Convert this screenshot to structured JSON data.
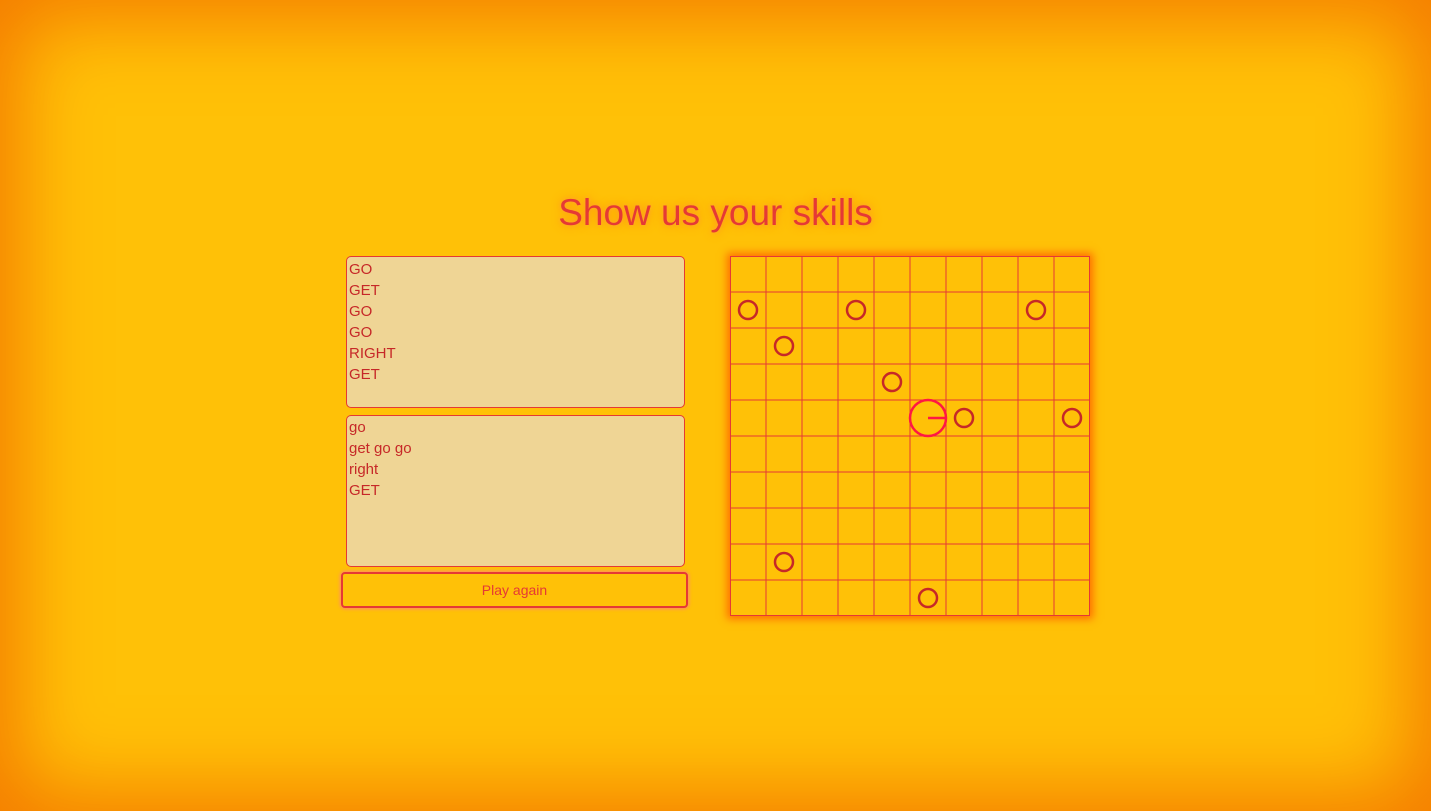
{
  "title": "Show us your skills",
  "program_output": {
    "lines": [
      "GO",
      "GET",
      "GO",
      "GO",
      "RIGHT",
      "GET"
    ]
  },
  "program_input": {
    "lines": [
      "go",
      "get go go",
      "right",
      "GET"
    ]
  },
  "play_again_label": "Play again",
  "board": {
    "columns": 10,
    "rows": 10,
    "items": [
      {
        "col": 0,
        "row": 1
      },
      {
        "col": 3,
        "row": 1
      },
      {
        "col": 8,
        "row": 1
      },
      {
        "col": 1,
        "row": 2
      },
      {
        "col": 4,
        "row": 3
      },
      {
        "col": 6,
        "row": 4
      },
      {
        "col": 9,
        "row": 4
      },
      {
        "col": 1,
        "row": 8
      },
      {
        "col": 5,
        "row": 9
      }
    ],
    "player": {
      "col": 5,
      "row": 4,
      "facing": "right"
    }
  },
  "colors": {
    "background": "#ffc107",
    "accent": "#e53935",
    "item": "#c62828",
    "panel": "#efd595"
  }
}
